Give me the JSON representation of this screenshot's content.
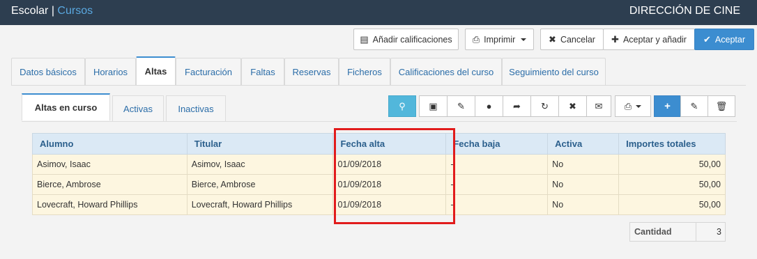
{
  "header": {
    "app": "Escolar",
    "separator": "|",
    "section": "Cursos",
    "right_title": "DIRECCIÓN DE CINE"
  },
  "actions": {
    "add_grades": "Añadir calificaciones",
    "print": "Imprimir",
    "cancel": "Cancelar",
    "accept_add": "Aceptar y añadir",
    "accept": "Aceptar"
  },
  "tabs": [
    {
      "label": "Datos básicos"
    },
    {
      "label": "Horarios"
    },
    {
      "label": "Altas"
    },
    {
      "label": "Facturación"
    },
    {
      "label": "Faltas"
    },
    {
      "label": "Reservas"
    },
    {
      "label": "Ficheros"
    },
    {
      "label": "Calificaciones del curso"
    },
    {
      "label": "Seguimiento del curso"
    }
  ],
  "subtabs": [
    {
      "label": "Altas en curso"
    },
    {
      "label": "Activas"
    },
    {
      "label": "Inactivas"
    }
  ],
  "table": {
    "headers": [
      "Alumno",
      "Titular",
      "Fecha alta",
      "Fecha baja",
      "Activa",
      "Importes totales"
    ],
    "rows": [
      [
        "Asimov, Isaac",
        "Asimov, Isaac",
        "01/09/2018",
        "-",
        "No",
        "50,00"
      ],
      [
        "Bierce, Ambrose",
        "Bierce, Ambrose",
        "01/09/2018",
        "-",
        "No",
        "50,00"
      ],
      [
        "Lovecraft, Howard Phillips",
        "Lovecraft, Howard Phillips",
        "01/09/2018",
        "-",
        "No",
        "50,00"
      ]
    ]
  },
  "summary": {
    "label": "Cantidad",
    "value": "3"
  },
  "colors": {
    "topbar": "#2d3e50",
    "accent": "#3c8dd0",
    "highlight": "#e11b1b"
  }
}
